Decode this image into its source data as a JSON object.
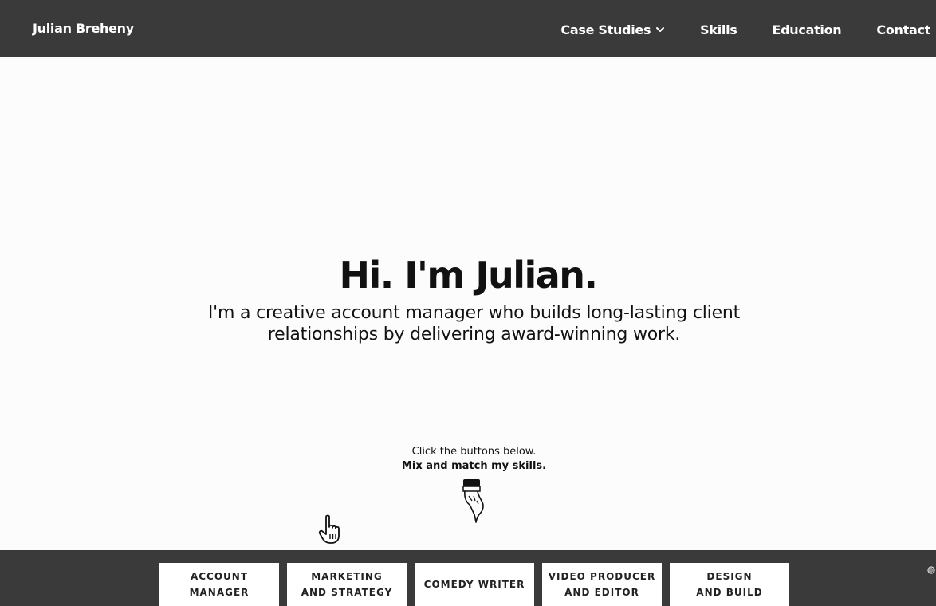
{
  "header": {
    "brand": "Julian Breheny",
    "nav": [
      {
        "label": "Case Studies",
        "has_dropdown": true
      },
      {
        "label": "Skills"
      },
      {
        "label": "Education"
      },
      {
        "label": "Contact"
      }
    ]
  },
  "hero": {
    "headline": "Hi. I'm Julian.",
    "subline": "I'm a creative account manager who builds long-lasting client relationships by delivering award-winning work.",
    "prompt_line1": "Click the buttons below.",
    "prompt_line2": "Mix and match my skills."
  },
  "skills": [
    {
      "label": "ACCOUNT\nMANAGER"
    },
    {
      "label": "MARKETING\nAND STRATEGY"
    },
    {
      "label": "COMEDY WRITER"
    },
    {
      "label": "VIDEO PRODUCER\nAND EDITOR"
    },
    {
      "label": "DESIGN\nAND BUILD"
    }
  ],
  "icons": {
    "dropdown": "chevron-down-icon",
    "pointer": "pointing-hand-down-icon",
    "cursor": "hand-cursor-icon",
    "corner": "accessibility-icon"
  },
  "colors": {
    "bar_background": "#3a3a3a",
    "text_light": "#ffffff",
    "text_dark": "#111111",
    "button_background": "#ffffff"
  }
}
